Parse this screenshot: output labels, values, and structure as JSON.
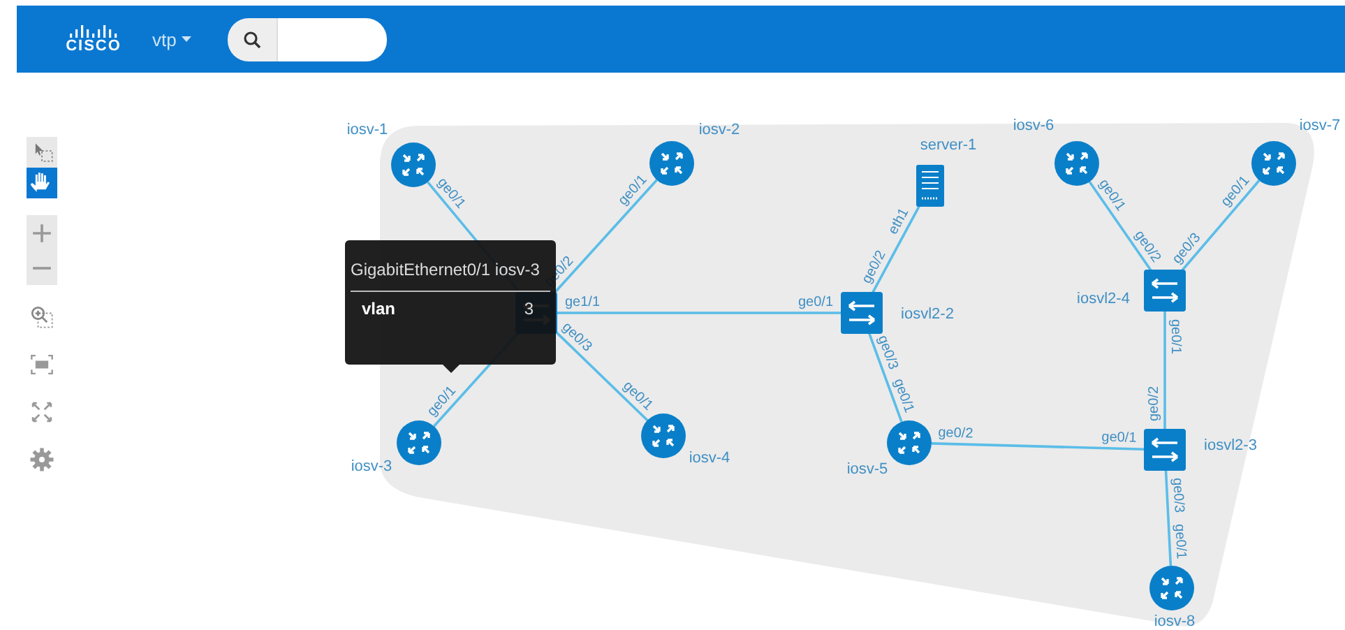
{
  "header": {
    "logo": "CISCO",
    "menu": {
      "label": "vtp"
    }
  },
  "toolbar": {
    "modes": [
      {
        "kind": "select",
        "selected": false
      },
      {
        "kind": "pan",
        "selected": true
      }
    ],
    "actions": [
      {
        "kind": "zoom-in"
      },
      {
        "kind": "zoom-out"
      },
      {
        "kind": "zoom-region"
      },
      {
        "kind": "fit"
      },
      {
        "kind": "expand"
      },
      {
        "kind": "settings"
      }
    ]
  },
  "topology": {
    "nodes": [
      {
        "name": "iosv-1",
        "kind": "router"
      },
      {
        "name": "iosv-2",
        "kind": "router"
      },
      {
        "name": "server-1",
        "kind": "server"
      },
      {
        "name": "iosv-6",
        "kind": "router"
      },
      {
        "name": "iosv-7",
        "kind": "router"
      },
      {
        "kind": "switch"
      },
      {
        "name": "iosvl2-2",
        "kind": "switch"
      },
      {
        "name": "iosvl2-4",
        "kind": "switch"
      },
      {
        "name": "iosv-3",
        "kind": "router"
      },
      {
        "name": "iosv-4",
        "kind": "router"
      },
      {
        "name": "iosv-5",
        "kind": "router"
      },
      {
        "name": "iosvl2-3",
        "kind": "switch"
      },
      {
        "name": "iosv-8",
        "kind": "router"
      }
    ],
    "links": [
      {
        "a_port": "ge0/1"
      },
      {
        "a_port": "ge0/1",
        "b_port": "ge0/2"
      },
      {
        "a_port": "ge1/1",
        "b_port": "ge0/1"
      },
      {
        "a_port": "ge0/3",
        "b_port": "ge0/1"
      },
      {
        "a_port": "ge0/1"
      },
      {
        "a_port": "eth1",
        "b_port": "ge0/2"
      },
      {
        "a_port": "ge0/3",
        "b_port": "ge0/1"
      },
      {
        "a_port": "ge0/2",
        "b_port": "ge0/1"
      },
      {
        "a_port": "ge0/1",
        "b_port": "ge0/2"
      },
      {
        "a_port": "ge0/1",
        "b_port": "ge0/3"
      },
      {
        "a_port": "ge0/1",
        "b_port": "ge0/2"
      },
      {
        "a_port": "ge0/3",
        "b_port": "ge0/1"
      }
    ]
  },
  "tooltip": {
    "title": "GigabitEthernet0/1 iosv-3",
    "rows": [
      {
        "key": "vlan",
        "value": "3"
      }
    ]
  }
}
